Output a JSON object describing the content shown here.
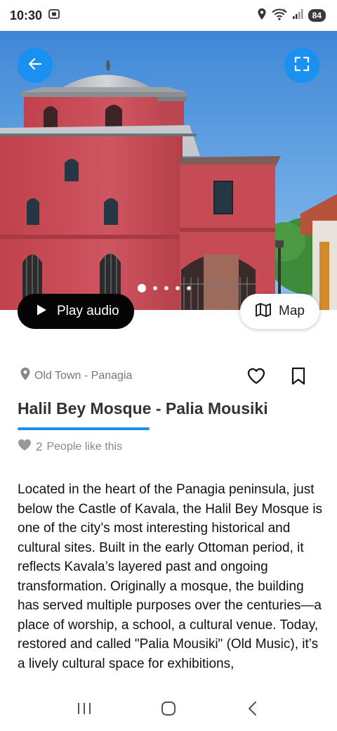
{
  "status_bar": {
    "time": "10:30",
    "battery": "84",
    "signal_label": "6"
  },
  "hero": {
    "pager": {
      "count": 5,
      "active_index": 0
    }
  },
  "actions": {
    "play_audio_label": "Play audio",
    "map_label": "Map"
  },
  "place": {
    "location": "Old Town - Panagia",
    "title": "Halil Bey Mosque - Palia Mousiki",
    "likes_count": "2",
    "likes_text": "People like this",
    "description": "Located in the heart of the Panagia peninsula, just below the Castle of Kavala, the Halil Bey Mosque is one of the city’s most interesting historical and cultural sites. Built in the early Ottoman period, it reflects Kavala’s layered past and ongoing transformation. Originally a mosque, the building has served multiple purposes over the centuries—a place of worship, a school, a cultural venue. Today, restored and called \"Palia Mousiki\" (Old Music), it’s a lively cultural space for exhibitions,"
  },
  "colors": {
    "accent": "#1a91f0",
    "play_button": "#050505",
    "building": "#c84a52",
    "sky": "#4d94dd"
  },
  "icons": [
    "screenshot-icon",
    "location-icon",
    "wifi-icon",
    "signal-icon",
    "arrow-left-icon",
    "fullscreen-icon",
    "play-icon",
    "map-icon",
    "pin-icon",
    "heart-outline-icon",
    "bookmark-icon",
    "heart-filled-icon",
    "recent-apps-icon",
    "home-icon",
    "back-icon"
  ]
}
